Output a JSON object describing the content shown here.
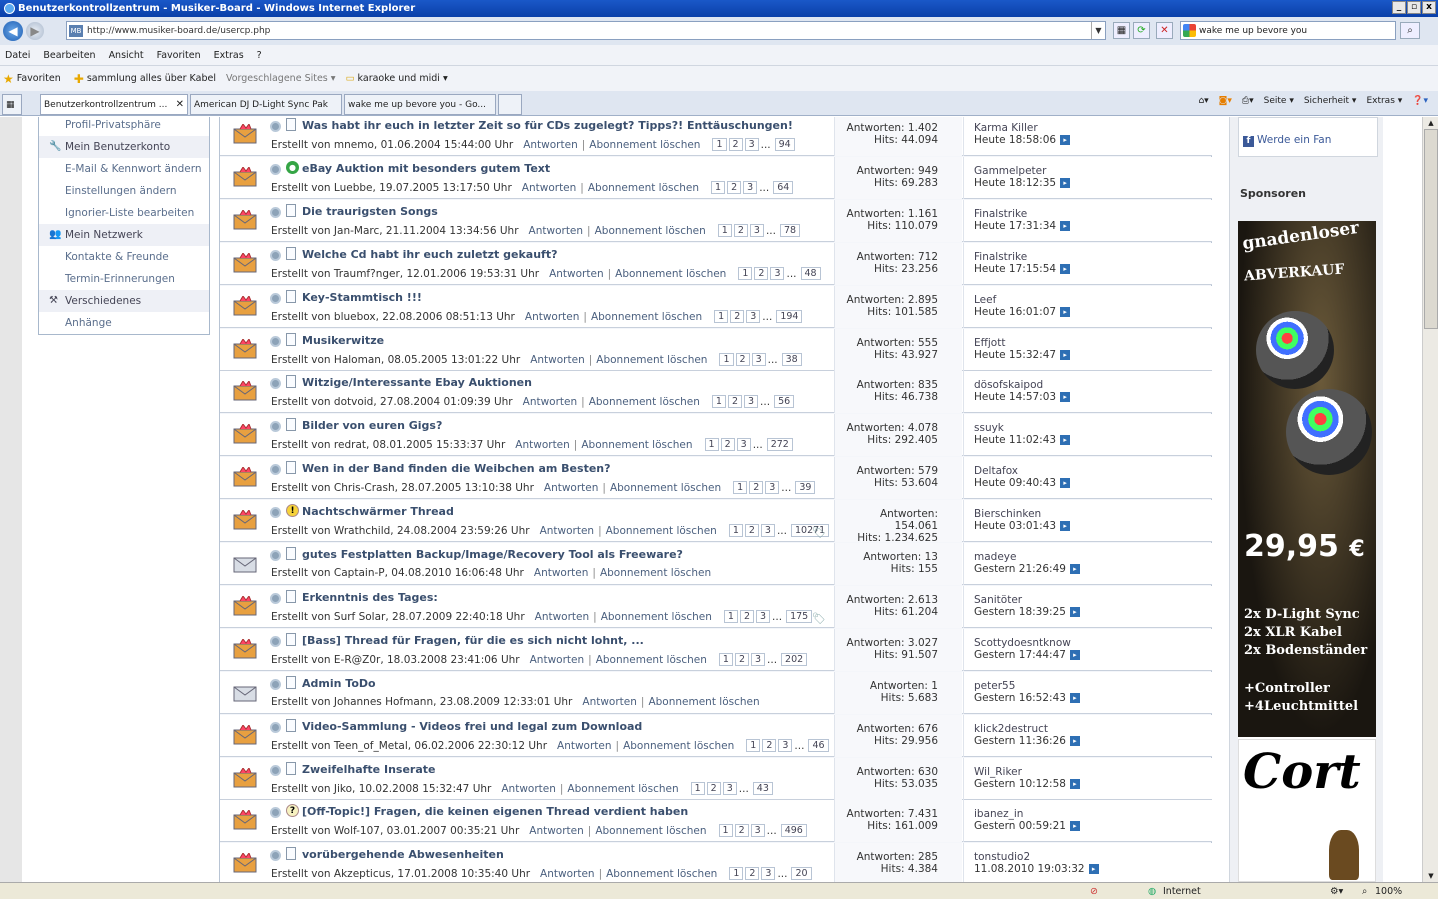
{
  "window": {
    "title": "Benutzerkontrollzentrum - Musiker-Board - Windows Internet Explorer"
  },
  "address": {
    "url": "http://www.musiker-board.de/usercp.php",
    "search_value": "wake me up bevore you"
  },
  "menu": [
    "Datei",
    "Bearbeiten",
    "Ansicht",
    "Favoriten",
    "Extras",
    "?"
  ],
  "favorites": {
    "label": "Favoriten",
    "items": [
      "sammlung alles über Kabel",
      "Vorgeschlagene Sites ▾",
      "karaoke und midi ▾"
    ]
  },
  "tabs": [
    "Benutzerkontrollzentrum ...",
    "American DJ D-Light Sync Pak",
    "wake me up bevore you - Go..."
  ],
  "cmdbar": [
    "Seite ▾",
    "Sicherheit ▾",
    "Extras ▾"
  ],
  "sidebar": {
    "items": [
      {
        "type": "item",
        "label": "Profil-Privatsphäre"
      },
      {
        "type": "head",
        "label": "Mein Benutzerkonto",
        "icon": "wrench-icon"
      },
      {
        "type": "item",
        "label": "E-Mail & Kennwort ändern"
      },
      {
        "type": "item",
        "label": "Einstellungen ändern"
      },
      {
        "type": "item",
        "label": "Ignorier-Liste bearbeiten"
      },
      {
        "type": "head",
        "label": "Mein Netzwerk",
        "icon": "people-icon"
      },
      {
        "type": "item",
        "label": "Kontakte & Freunde"
      },
      {
        "type": "item",
        "label": "Termin-Erinnerungen"
      },
      {
        "type": "head",
        "label": "Verschiedenes",
        "icon": "tools-icon"
      },
      {
        "type": "item",
        "label": "Anhänge"
      }
    ]
  },
  "thread_actions": {
    "reply": "Antworten",
    "unsubscribe": "Abonnement löschen"
  },
  "threads": [
    {
      "title": "Was habt ihr euch in letzter Zeit so für CDs zugelegt? Tipps?! Enttäuschungen!",
      "created": "Erstellt von mnemo, 01.06.2004 15:44:00 Uhr",
      "pages": [
        "1",
        "2",
        "3",
        "94"
      ],
      "replies": "Antworten: 1.402",
      "hits": "Hits: 44.094",
      "last_user": "Karma Killer",
      "last_time": "Heute 18:58:06",
      "icon": "page"
    },
    {
      "title": "eBay Auktion mit besonders gutem Text",
      "created": "Erstellt von Luebbe, 19.07.2005 13:17:50 Uhr",
      "pages": [
        "1",
        "2",
        "3",
        "64"
      ],
      "replies": "Antworten: 949",
      "hits": "Hits: 69.283",
      "last_user": "Gammelpeter",
      "last_time": "Heute 18:12:35",
      "icon": "green"
    },
    {
      "title": "Die traurigsten Songs",
      "created": "Erstellt von Jan-Marc, 21.11.2004 13:34:56 Uhr",
      "pages": [
        "1",
        "2",
        "3",
        "78"
      ],
      "replies": "Antworten: 1.161",
      "hits": "Hits: 110.079",
      "last_user": "Finalstrike",
      "last_time": "Heute 17:31:34",
      "icon": "page"
    },
    {
      "title": "Welche Cd habt ihr euch zuletzt gekauft?",
      "created": "Erstellt von Traumf?nger, 12.01.2006 19:53:31 Uhr",
      "pages": [
        "1",
        "2",
        "3",
        "48"
      ],
      "replies": "Antworten: 712",
      "hits": "Hits: 23.256",
      "last_user": "Finalstrike",
      "last_time": "Heute 17:15:54",
      "icon": "page"
    },
    {
      "title": "Key-Stammtisch !!!",
      "created": "Erstellt von bluebox, 22.08.2006 08:51:13 Uhr",
      "pages": [
        "1",
        "2",
        "3",
        "194"
      ],
      "replies": "Antworten: 2.895",
      "hits": "Hits: 101.585",
      "last_user": "Leef",
      "last_time": "Heute 16:01:07",
      "icon": "page"
    },
    {
      "title": "Musikerwitze",
      "created": "Erstellt von Haloman, 08.05.2005 13:01:22 Uhr",
      "pages": [
        "1",
        "2",
        "3",
        "38"
      ],
      "replies": "Antworten: 555",
      "hits": "Hits: 43.927",
      "last_user": "Effjott",
      "last_time": "Heute 15:32:47",
      "icon": "page"
    },
    {
      "title": "Witzige/Interessante Ebay Auktionen",
      "created": "Erstellt von dotvoid, 27.08.2004 01:09:39 Uhr",
      "pages": [
        "1",
        "2",
        "3",
        "56"
      ],
      "replies": "Antworten: 835",
      "hits": "Hits: 46.738",
      "last_user": "dösofskaipod",
      "last_time": "Heute 14:57:03",
      "icon": "page"
    },
    {
      "title": "Bilder von euren Gigs?",
      "created": "Erstellt von redrat, 08.01.2005 15:33:37 Uhr",
      "pages": [
        "1",
        "2",
        "3",
        "272"
      ],
      "replies": "Antworten: 4.078",
      "hits": "Hits: 292.405",
      "last_user": "ssuyk",
      "last_time": "Heute 11:02:43",
      "icon": "page"
    },
    {
      "title": "Wen in der Band finden die Weibchen am Besten?",
      "created": "Erstellt von Chris-Crash, 28.07.2005 13:10:38 Uhr",
      "pages": [
        "1",
        "2",
        "3",
        "39"
      ],
      "replies": "Antworten: 579",
      "hits": "Hits: 53.604",
      "last_user": "Deltafox",
      "last_time": "Heute 09:40:43",
      "icon": "page"
    },
    {
      "title": "Nachtschwärmer Thread",
      "created": "Erstellt von Wrathchild, 24.08.2004 23:59:26 Uhr",
      "pages": [
        "1",
        "2",
        "3",
        "10271"
      ],
      "replies": "Antworten: 154.061",
      "hits": "Hits: 1.234.625",
      "last_user": "Bierschinken",
      "last_time": "Heute 03:01:43",
      "icon": "warn",
      "tag": true
    },
    {
      "title": "gutes Festplatten Backup/Image/Recovery Tool als Freeware?",
      "created": "Erstellt von Captain-P, 04.08.2010 16:06:48 Uhr",
      "pages": [],
      "replies": "Antworten: 13",
      "hits": "Hits: 155",
      "last_user": "madeye",
      "last_time": "Gestern 21:26:49",
      "icon": "page"
    },
    {
      "title": "Erkenntnis des Tages:",
      "created": "Erstellt von Surf Solar, 28.07.2009 22:40:18 Uhr",
      "pages": [
        "1",
        "2",
        "3",
        "175"
      ],
      "replies": "Antworten: 2.613",
      "hits": "Hits: 61.204",
      "last_user": "Sanitöter",
      "last_time": "Gestern 18:39:25",
      "icon": "page",
      "tag": true
    },
    {
      "title": "[Bass] Thread für Fragen, für die es sich nicht lohnt, ...",
      "created": "Erstellt von E-R@Z0r, 18.03.2008 23:41:06 Uhr",
      "pages": [
        "1",
        "2",
        "3",
        "202"
      ],
      "replies": "Antworten: 3.027",
      "hits": "Hits: 91.507",
      "last_user": "Scottydoesntknow",
      "last_time": "Gestern 17:44:47",
      "icon": "page"
    },
    {
      "title": "Admin ToDo",
      "created": "Erstellt von Johannes Hofmann, 23.08.2009 12:33:01 Uhr",
      "pages": [],
      "replies": "Antworten: 1",
      "hits": "Hits: 5.683",
      "last_user": "peter55",
      "last_time": "Gestern 16:52:43",
      "icon": "page"
    },
    {
      "title": "Video-Sammlung - Videos frei und legal zum Download",
      "created": "Erstellt von Teen_of_Metal, 06.02.2006 22:30:12 Uhr",
      "pages": [
        "1",
        "2",
        "3",
        "46"
      ],
      "replies": "Antworten: 676",
      "hits": "Hits: 29.956",
      "last_user": "klick2destruct",
      "last_time": "Gestern 11:36:26",
      "icon": "page"
    },
    {
      "title": "Zweifelhafte Inserate",
      "created": "Erstellt von Jiko, 10.02.2008 15:32:47 Uhr",
      "pages": [
        "1",
        "2",
        "3",
        "43"
      ],
      "replies": "Antworten: 630",
      "hits": "Hits: 53.035",
      "last_user": "Wil_Riker",
      "last_time": "Gestern 10:12:58",
      "icon": "page"
    },
    {
      "title": "[Off-Topic!] Fragen, die keinen eigenen Thread verdient haben",
      "created": "Erstellt von Wolf-107, 03.01.2007 00:35:21 Uhr",
      "pages": [
        "1",
        "2",
        "3",
        "496"
      ],
      "replies": "Antworten: 7.431",
      "hits": "Hits: 161.009",
      "last_user": "ibanez_in",
      "last_time": "Gestern 00:59:21",
      "icon": "quest"
    },
    {
      "title": "vorübergehende Abwesenheiten",
      "created": "Erstellt von Akzepticus, 17.01.2008 10:35:40 Uhr",
      "pages": [
        "1",
        "2",
        "3",
        "20"
      ],
      "replies": "Antworten: 285",
      "hits": "Hits: 4.384",
      "last_user": "tonstudio2",
      "last_time": "11.08.2010 19:03:32",
      "icon": "page"
    }
  ],
  "rightcol": {
    "fan": "Werde ein Fan",
    "sponsors": "Sponsoren"
  },
  "ad1": {
    "headline1": "gnadenloser",
    "headline2": "ABVERKAUF",
    "price": "29,95",
    "currency": "€",
    "lines": [
      "2x D-Light Sync",
      "2x XLR Kabel",
      "2x Bodenständer",
      "+Controller",
      "+4Leuchtmittel"
    ]
  },
  "ad2": {
    "brand": "Cort"
  },
  "status": {
    "zone": "Internet",
    "zoom": "100%"
  }
}
